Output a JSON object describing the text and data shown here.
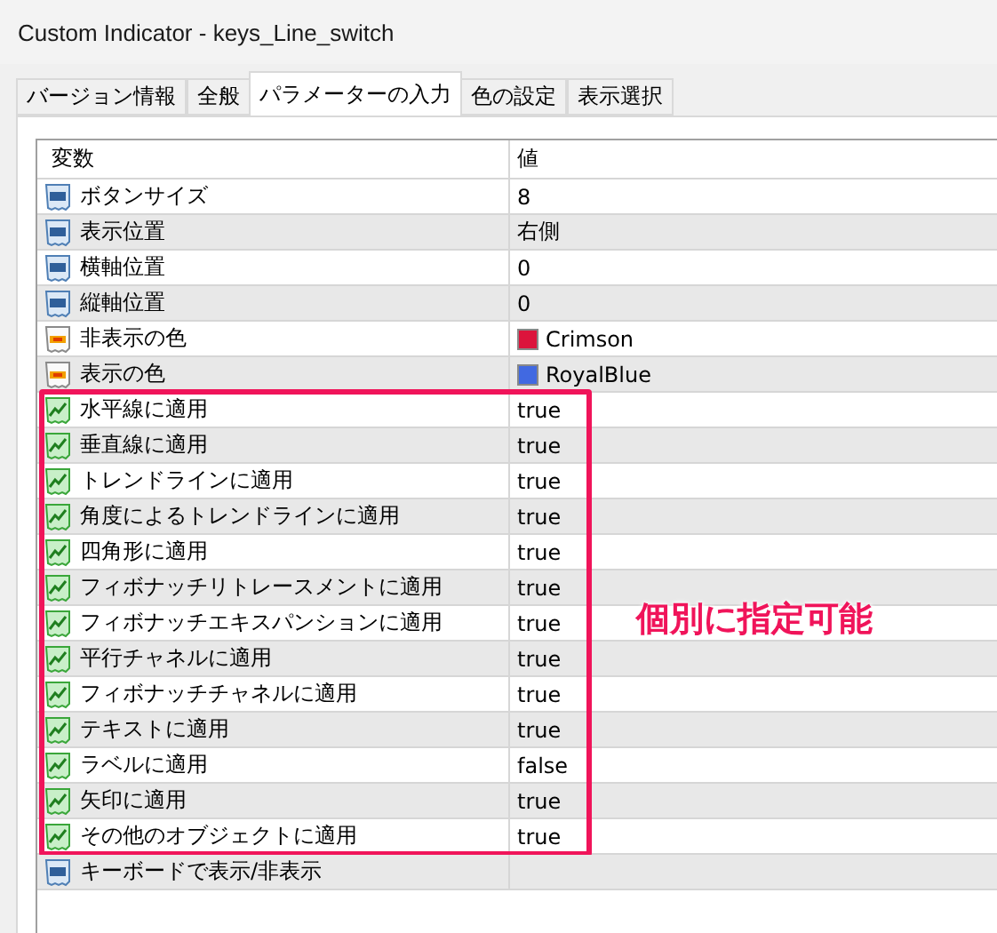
{
  "window": {
    "title": "Custom Indicator - keys_Line_switch"
  },
  "tabs": [
    {
      "label": "バージョン情報",
      "selected": false
    },
    {
      "label": "全般",
      "selected": false
    },
    {
      "label": "パラメーターの入力",
      "selected": true
    },
    {
      "label": "色の設定",
      "selected": false
    },
    {
      "label": "表示選択",
      "selected": false
    }
  ],
  "table": {
    "columns": [
      "変数",
      "値"
    ],
    "sections": [
      {
        "kind": "plain",
        "rows": [
          {
            "kind": "number",
            "name": "ボタンサイズ",
            "value": "8"
          },
          {
            "kind": "number",
            "name": "表示位置",
            "value": "右側"
          },
          {
            "kind": "number",
            "name": "横軸位置",
            "value": "0"
          },
          {
            "kind": "number",
            "name": "縦軸位置",
            "value": "0"
          },
          {
            "kind": "color",
            "name": "非表示の色",
            "value": "Crimson",
            "color": "#dc143c"
          },
          {
            "kind": "color",
            "name": "表示の色",
            "value": "RoyalBlue",
            "color": "#4169e1"
          }
        ]
      },
      {
        "kind": "framed",
        "callout": "個別に指定可能",
        "rows": [
          {
            "kind": "bool",
            "name": "水平線に適用",
            "value": "true"
          },
          {
            "kind": "bool",
            "name": "垂直線に適用",
            "value": "true"
          },
          {
            "kind": "bool",
            "name": "トレンドラインに適用",
            "value": "true"
          },
          {
            "kind": "bool",
            "name": "角度によるトレンドラインに適用",
            "value": "true"
          },
          {
            "kind": "bool",
            "name": "四角形に適用",
            "value": "true"
          },
          {
            "kind": "bool",
            "name": "フィボナッチリトレースメントに適用",
            "value": "true"
          },
          {
            "kind": "bool",
            "name": "フィボナッチエキスパンションに適用",
            "value": "true"
          },
          {
            "kind": "bool",
            "name": "平行チャネルに適用",
            "value": "true"
          },
          {
            "kind": "bool",
            "name": "フィボナッチチャネルに適用",
            "value": "true"
          },
          {
            "kind": "bool",
            "name": "テキストに適用",
            "value": "true"
          },
          {
            "kind": "bool",
            "name": "ラベルに適用",
            "value": "false"
          },
          {
            "kind": "bool",
            "name": "矢印に適用",
            "value": "true"
          },
          {
            "kind": "bool",
            "name": "その他のオブジェクトに適用",
            "value": "true"
          }
        ]
      },
      {
        "kind": "plain",
        "rows": [
          {
            "kind": "number",
            "name": "キーボードで表示/非表示"
          }
        ]
      }
    ]
  }
}
